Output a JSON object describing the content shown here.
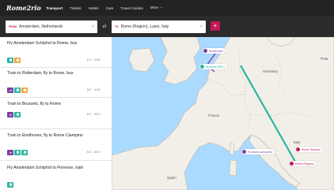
{
  "app": {
    "logo": "Rome2rio"
  },
  "nav": {
    "items": [
      "Transport",
      "Tickets",
      "Hotels",
      "Cars",
      "Travel Guides",
      "More ⋯"
    ]
  },
  "search": {
    "from_tag": "FROM",
    "from_value": "Amsterdam, Netherlands",
    "to_tag": "TO",
    "to_value": "Rome (Region), Lazio, Italy",
    "clear": "×",
    "swap": "⇄",
    "add": "+"
  },
  "routes": [
    {
      "title": "Fly Amsterdam Schiphol to Rome, bus",
      "duration": "",
      "price": "$70 - $580",
      "modes": [
        "train",
        "bus"
      ]
    },
    {
      "title": "Train to Rotterdam, fly to Rome, bus",
      "duration": "",
      "price": "$87 - $425",
      "modes": [
        "fly",
        "train",
        "bus"
      ]
    },
    {
      "title": "Train to Brussels, fly to Rome",
      "duration": "",
      "price": "$97 - $594",
      "modes": [
        "fly",
        "train"
      ]
    },
    {
      "title": "Train to Eindhoven, fly to Rome Ciampino",
      "duration": "",
      "price": "$81 - $509",
      "modes": [
        "fly",
        "train",
        "train"
      ]
    },
    {
      "title": "Fly Amsterdam Schiphol to Florence, train",
      "duration": "",
      "price": "",
      "modes": [
        "train"
      ]
    }
  ],
  "map": {
    "pins": {
      "amsterdam": "Amsterdam",
      "brussels": "Brussels (BRU)",
      "fiumicino": "Fiumicino Aeroporto",
      "rome_tiburtina": "Rome Tiburtina",
      "rome_region": "Rome (Region)"
    },
    "labels": {
      "germany": "Germany",
      "poland": "Pola",
      "france": "France",
      "italy": "Italy",
      "spain": "Spain"
    }
  },
  "colors": {
    "accent": "#c2185b",
    "fly": "#7b3fa0",
    "bus": "#f0a33a",
    "train": "#2bb5a3",
    "water": "#aadaff",
    "land": "#f2efe9"
  }
}
